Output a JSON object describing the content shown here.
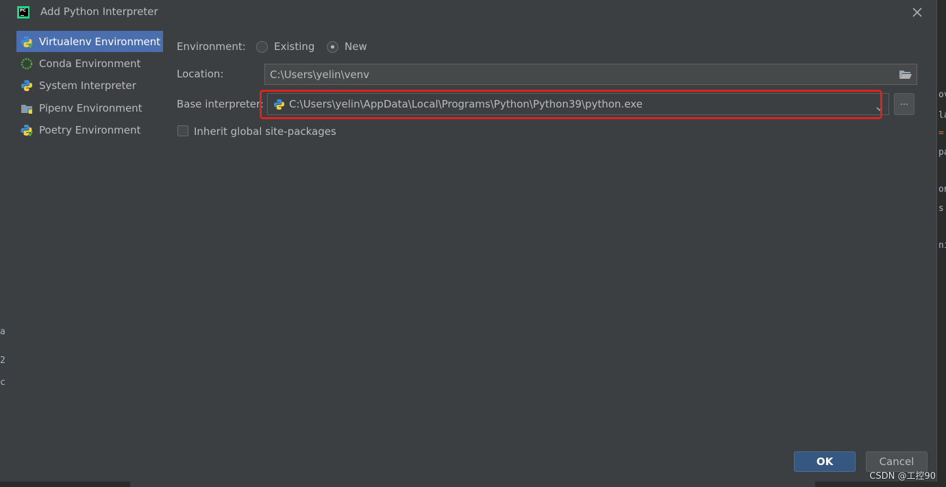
{
  "dialog": {
    "title": "Add Python Interpreter"
  },
  "sidebar": {
    "items": [
      {
        "label": "Virtualenv Environment",
        "selected": true
      },
      {
        "label": "Conda Environment",
        "selected": false
      },
      {
        "label": "System Interpreter",
        "selected": false
      },
      {
        "label": "Pipenv Environment",
        "selected": false
      },
      {
        "label": "Poetry Environment",
        "selected": false
      }
    ]
  },
  "form": {
    "environment_label": "Environment:",
    "environment_options": [
      "Existing",
      "New"
    ],
    "environment_selected": "New",
    "location_label": "Location:",
    "location_value": "C:\\Users\\yelin\\venv",
    "base_interpreter_label": "Base interpreter:",
    "base_interpreter_value": "C:\\Users\\yelin\\AppData\\Local\\Programs\\Python\\Python39\\python.exe",
    "browse_label": "...",
    "inherit_label": "Inherit global site-packages",
    "inherit_checked": false
  },
  "buttons": {
    "ok": "OK",
    "cancel": "Cancel"
  },
  "watermark": "CSDN @工控90",
  "background_fragments": {
    "left": [
      "al",
      "2",
      "c"
    ],
    "right": [
      "ov",
      "la",
      "=",
      "pa",
      "on",
      "s",
      "ni"
    ]
  },
  "colors": {
    "accent_selected": "#4b6eaf",
    "ok_button": "#365880",
    "highlight_box": "#e0231b"
  }
}
